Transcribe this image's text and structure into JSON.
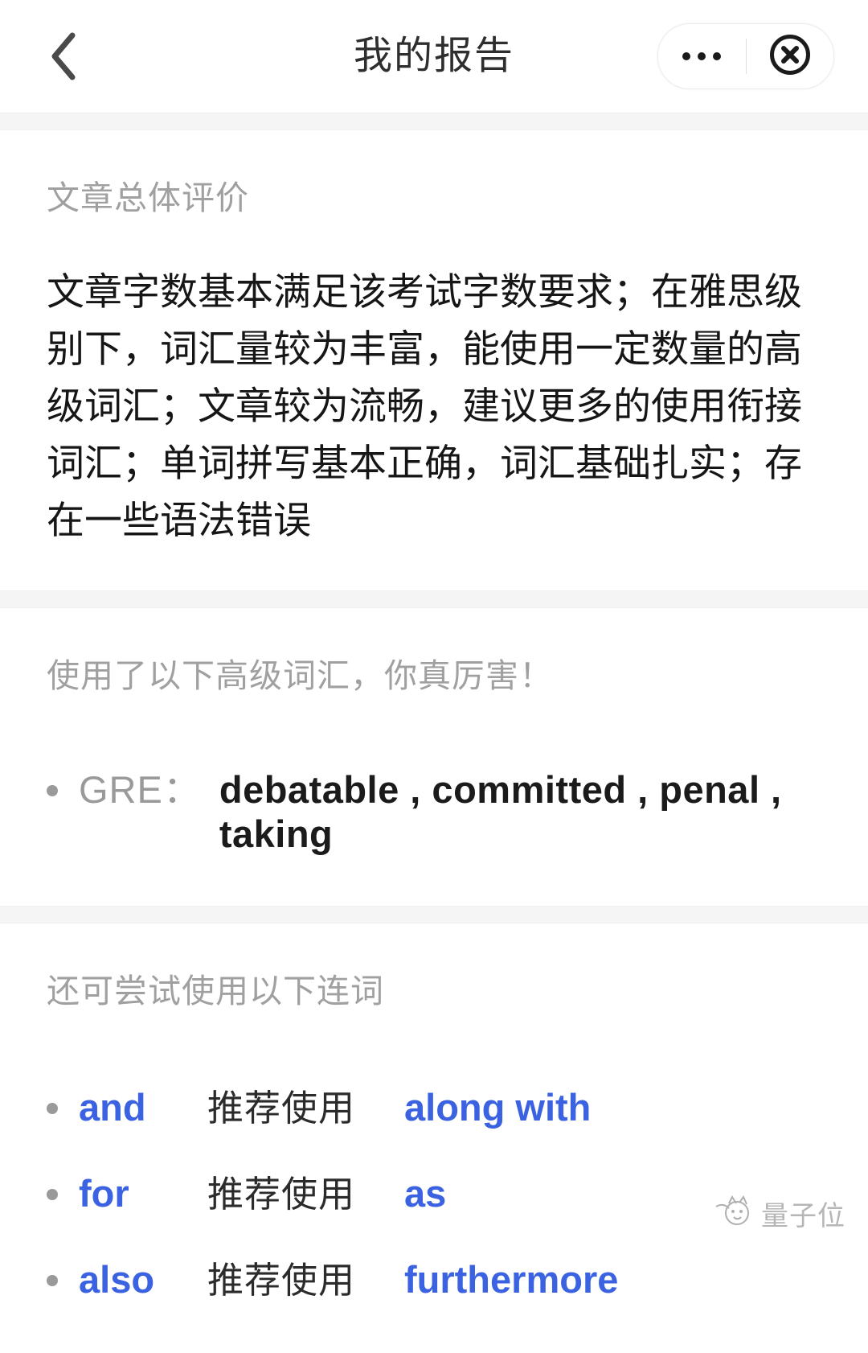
{
  "header": {
    "title": "我的报告",
    "back_icon": "chevron-left-icon",
    "more_icon": "more-dots-icon",
    "close_icon": "close-circle-icon"
  },
  "sections": {
    "overall": {
      "heading": "文章总体评价",
      "body": "文章字数基本满足该考试字数要求；在雅思级别下，词汇量较为丰富，能使用一定数量的高级词汇；文章较为流畅，建议更多的使用衔接词汇；单词拼写基本正确，词汇基础扎实；存在一些语法错误"
    },
    "advanced_vocab": {
      "heading": "使用了以下高级词汇，你真厉害！",
      "rows": [
        {
          "label": "GRE：",
          "words": "debatable , committed , penal , taking"
        }
      ]
    },
    "conjunctions": {
      "heading": "还可尝试使用以下连词",
      "rows": [
        {
          "from": "and",
          "middle": "推荐使用",
          "to": "along with"
        },
        {
          "from": "for",
          "middle": "推荐使用",
          "to": "as"
        },
        {
          "from": "also",
          "middle": "推荐使用",
          "to": "furthermore"
        }
      ]
    }
  },
  "watermark": {
    "text": "量子位",
    "icon": "mascot-icon"
  },
  "colors": {
    "link_blue": "#3b62e0",
    "heading_gray": "#a0a0a0",
    "body_black": "#161616",
    "divider_gray": "#f5f5f5"
  }
}
